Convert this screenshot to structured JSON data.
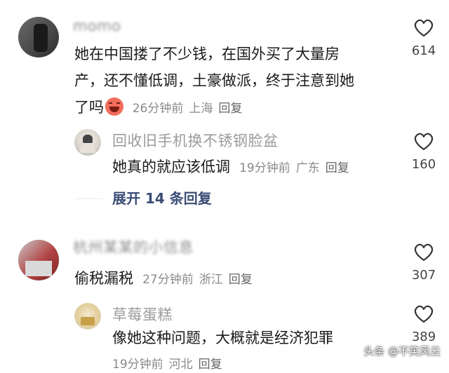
{
  "comments": [
    {
      "username": "momo",
      "text_lines": [
        "她在中国搂了不少钱，在国外买了大量房",
        "产，还不懂低调，土豪做派，终于注意到她",
        "了吗"
      ],
      "emoji": "emoji-icon",
      "time": "26分钟前",
      "location": "上海",
      "reply_label": "回复",
      "likes": "614",
      "replies": [
        {
          "username": "回收旧手机换不锈钢脸盆",
          "text": "她真的就应该低调",
          "time": "19分钟前",
          "location": "广东",
          "reply_label": "回复",
          "likes": "160"
        }
      ],
      "expand_label": "展开 14 条回复"
    },
    {
      "username": "杭州某某的小信息",
      "text": "偷税漏税",
      "time": "27分钟前",
      "location": "浙江",
      "reply_label": "回复",
      "likes": "307",
      "replies": [
        {
          "username": "草莓蛋糕",
          "text": "像她这种问题，大概就是经济犯罪",
          "time": "19分钟前",
          "location": "河北",
          "reply_label": "回复",
          "likes": "389"
        }
      ]
    }
  ],
  "watermark": "头条 @不笑风云",
  "colors": {
    "username": "#9b9b9b",
    "meta": "#8a8a8a",
    "expand": "#3a4d75",
    "heart_outline": "#333333"
  }
}
